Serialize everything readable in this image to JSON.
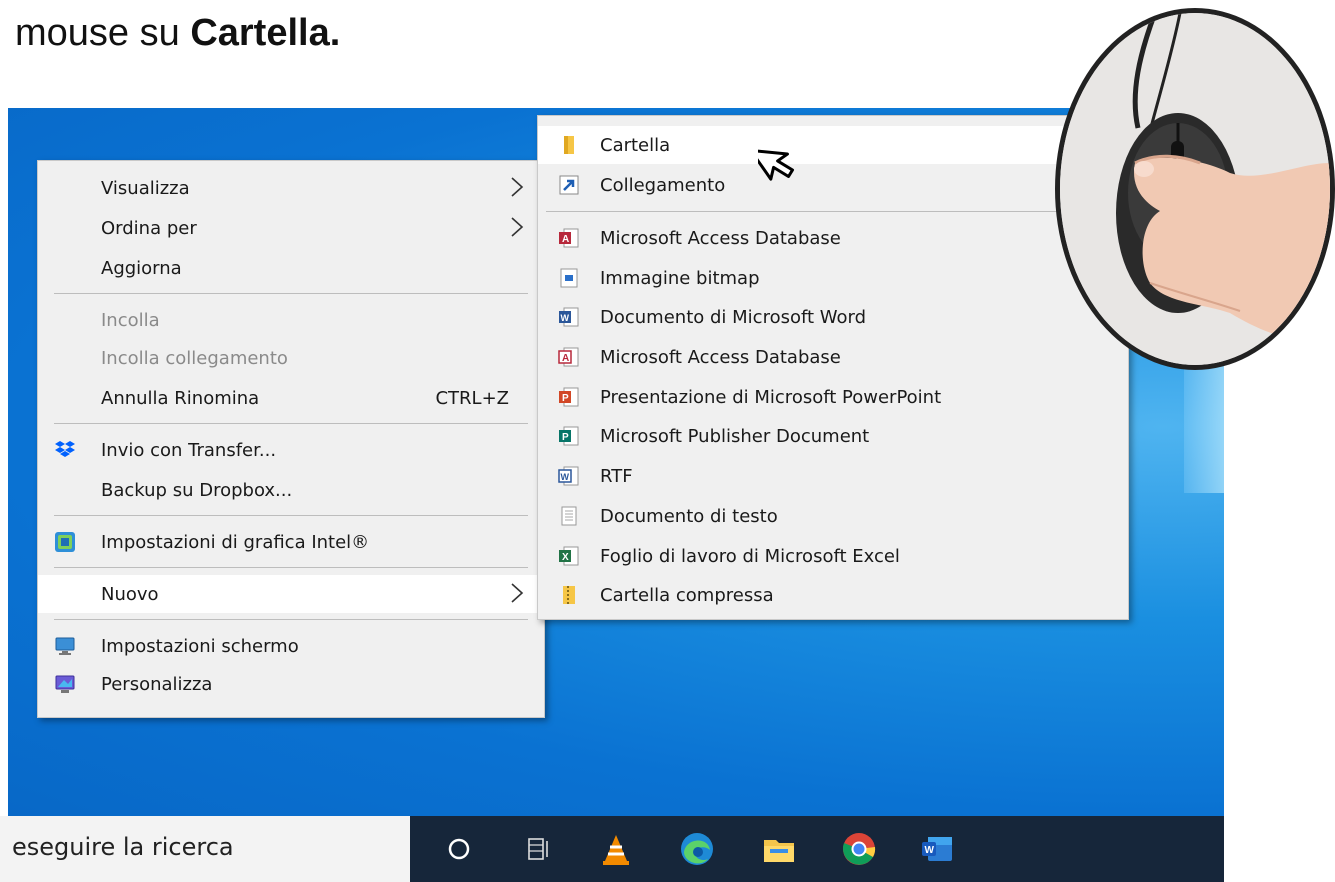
{
  "caption": {
    "prefix": "mouse su ",
    "bold": "Cartella."
  },
  "context_menu": {
    "items": [
      {
        "label": "Visualizza",
        "submenu": true
      },
      {
        "label": "Ordina per",
        "submenu": true
      },
      {
        "label": "Aggiorna"
      },
      {
        "label": "Incolla",
        "disabled": true
      },
      {
        "label": "Incolla collegamento",
        "disabled": true
      },
      {
        "label": "Annulla Rinomina",
        "shortcut": "CTRL+Z"
      },
      {
        "label": "Invio con Transfer...",
        "icon": "dropbox-icon"
      },
      {
        "label": "Backup su Dropbox..."
      },
      {
        "label": "Impostazioni di grafica Intel®",
        "icon": "intel-graphics-icon"
      },
      {
        "label": "Nuovo",
        "submenu": true,
        "highlighted": true
      },
      {
        "label": "Impostazioni schermo",
        "icon": "display-settings-icon"
      },
      {
        "label": "Personalizza",
        "icon": "personalize-icon"
      }
    ]
  },
  "new_submenu": {
    "items": [
      {
        "label": "Cartella",
        "icon": "folder-icon",
        "highlighted": true
      },
      {
        "label": "Collegamento",
        "icon": "shortcut-icon"
      },
      {
        "label": "Microsoft Access Database",
        "icon": "access-icon"
      },
      {
        "label": "Immagine bitmap",
        "icon": "bitmap-icon"
      },
      {
        "label": "Documento di Microsoft Word",
        "icon": "word-doc-icon"
      },
      {
        "label": "Microsoft Access Database",
        "icon": "access-icon"
      },
      {
        "label": "Presentazione di Microsoft PowerPoint",
        "icon": "powerpoint-icon"
      },
      {
        "label": "Microsoft Publisher Document",
        "icon": "publisher-icon"
      },
      {
        "label": "RTF",
        "icon": "rtf-icon"
      },
      {
        "label": "Documento di testo",
        "icon": "text-doc-icon"
      },
      {
        "label": "Foglio di lavoro di Microsoft Excel",
        "icon": "excel-icon"
      },
      {
        "label": "Cartella compressa",
        "icon": "zip-folder-icon"
      }
    ]
  },
  "taskbar": {
    "search_text": "eseguire la ricerca",
    "icons": [
      "cortana-icon",
      "task-view-icon",
      "vlc-icon",
      "edge-icon",
      "file-explorer-icon",
      "chrome-icon",
      "word-icon"
    ]
  },
  "colors": {
    "desktop": "#0a72d2",
    "menu_bg": "#f0f0f0",
    "taskbar": "#16263a"
  }
}
